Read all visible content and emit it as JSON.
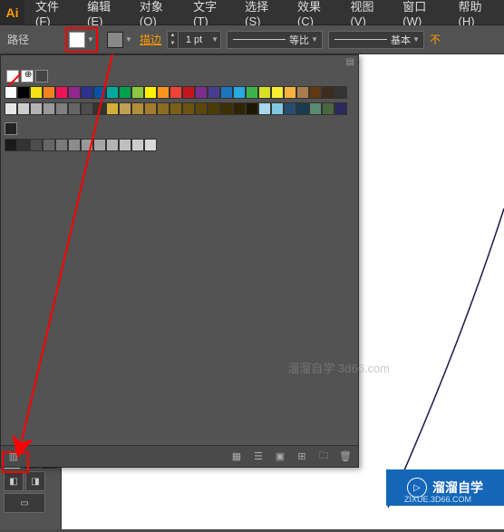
{
  "app": {
    "logo": "Ai"
  },
  "menu": [
    "文件(F)",
    "编辑(E)",
    "对象(O)",
    "文字(T)",
    "选择(S)",
    "效果(C)",
    "视图(V)",
    "窗口(W)",
    "帮助(H)"
  ],
  "control": {
    "path_label": "路径",
    "stroke_label": "描边",
    "stroke_value": "1 pt",
    "profile1": "等比",
    "profile2": "基本",
    "truncated": "不"
  },
  "swatch_colors_row1": [
    "#ffffff",
    "#000000",
    "#f7e214",
    "#f58220",
    "#ed145b",
    "#92278f",
    "#2e3192",
    "#0054a6",
    "#00a99d",
    "#00a14b",
    "#8dc63f",
    "#fff200",
    "#f7941e",
    "#ef4136",
    "#c4161c",
    "#7b2e8f",
    "#4b3c8f",
    "#1b75bc",
    "#27aae1",
    "#39b54a",
    "#d7df23",
    "#f9ed32",
    "#fbb040",
    "#a97c50",
    "#603913",
    "#3d2b1f",
    "#333333"
  ],
  "swatch_colors_row2": [
    "#e6e6e6",
    "#cccccc",
    "#b3b3b3",
    "#999999",
    "#808080",
    "#666666",
    "#4d4d4d",
    "#333333",
    "#d4af37",
    "#c0a050",
    "#b08d39",
    "#a37b2c",
    "#8c6d1f",
    "#7a5f15",
    "#6b520f",
    "#5c460a",
    "#4d3b06",
    "#3e2f03",
    "#2f2401",
    "#1f1800",
    "#a8d8ea",
    "#7ec8e3",
    "#264e70",
    "#1a3a52",
    "#5b8a72",
    "#4a6741",
    "#2a2a5e"
  ],
  "gray_ramp": [
    "#1a1a1a",
    "#333333",
    "#4d4d4d",
    "#666666",
    "#7a7a7a",
    "#8c8c8c",
    "#999999",
    "#a6a6a6",
    "#b3b3b3",
    "#bfbfbf",
    "#cccccc",
    "#d9d9d9"
  ],
  "watermark": {
    "text": "溜溜自学 3d66.com",
    "badge": "溜溜自学",
    "sub": "ZIXUE.3D66.COM"
  }
}
